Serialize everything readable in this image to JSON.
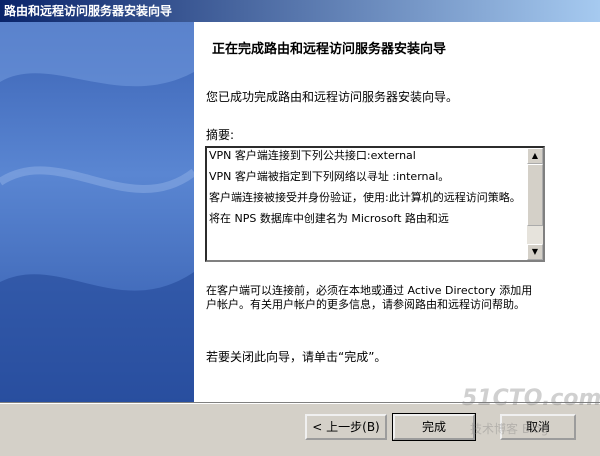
{
  "window": {
    "title": "路由和远程访问服务器安装向导"
  },
  "content": {
    "heading": "正在完成路由和远程访问服务器安装向导",
    "intro": "您已成功完成路由和远程访问服务器安装向导。",
    "summary_label": "摘要:",
    "summary_items": [
      "VPN 客户端连接到下列公共接口:external",
      "VPN 客户端被指定到下列网络以寻址 :internal。",
      "客户端连接被接受并身份验证，使用:此计算机的远程访问策略。",
      "将在 NPS 数据库中创建名为 Microsoft 路由和远"
    ],
    "note": "在客户端可以连接前，必须在本地或通过 Active Directory 添加用户帐户。有关用户帐户的更多信息，请参阅路由和远程访问帮助。",
    "closing": "若要关闭此向导，请单击“完成”。"
  },
  "buttons": {
    "back": "< 上一步(B)",
    "finish": "完成",
    "cancel": "取消"
  },
  "watermark": {
    "main": "51CTO.com",
    "sub": "技术博客  Blog"
  }
}
